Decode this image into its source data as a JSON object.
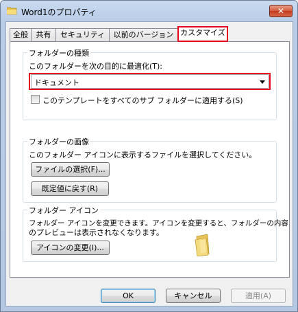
{
  "window": {
    "title": "Word1のプロパティ",
    "close_label": "✕"
  },
  "tabs": [
    {
      "label": "全般"
    },
    {
      "label": "共有"
    },
    {
      "label": "セキュリティ"
    },
    {
      "label": "以前のバージョン"
    },
    {
      "label": "カスタマイズ",
      "active": true
    }
  ],
  "folder_type_group": {
    "title": "フォルダーの種類",
    "optimize_label": "このフォルダーを次の目的に最適化(T):",
    "selected_option": "ドキュメント",
    "apply_subfolders_label": "このテンプレートをすべてのサブ フォルダーに適用する(S)",
    "apply_subfolders_checked": false
  },
  "folder_picture_group": {
    "title": "フォルダーの画像",
    "description": "このフォルダー アイコンに表示するファイルを選択してください。",
    "choose_file_label": "ファイルの選択(F)...",
    "restore_default_label": "既定値に戻す(R)"
  },
  "folder_icon_group": {
    "title": "フォルダー アイコン",
    "description_line1": "フォルダー アイコンを変更できます。アイコンを変更すると、フォルダーの内容",
    "description_line2": "のプレビューは表示されなくなります。",
    "change_icon_label": "アイコンの変更(I)..."
  },
  "footer": {
    "ok_label": "OK",
    "cancel_label": "キャンセル",
    "apply_label": "適用(A)"
  },
  "colors": {
    "highlight": "#e8001c",
    "folder": "#f2d36b"
  }
}
